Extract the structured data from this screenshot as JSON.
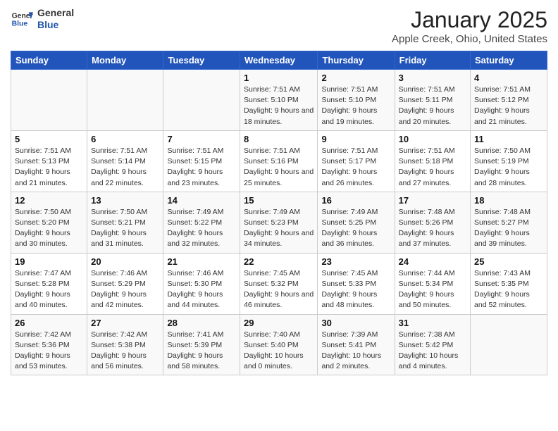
{
  "header": {
    "logo_general": "General",
    "logo_blue": "Blue",
    "month": "January 2025",
    "location": "Apple Creek, Ohio, United States"
  },
  "days_of_week": [
    "Sunday",
    "Monday",
    "Tuesday",
    "Wednesday",
    "Thursday",
    "Friday",
    "Saturday"
  ],
  "weeks": [
    [
      {
        "day": "",
        "info": ""
      },
      {
        "day": "",
        "info": ""
      },
      {
        "day": "",
        "info": ""
      },
      {
        "day": "1",
        "sunrise": "Sunrise: 7:51 AM",
        "sunset": "Sunset: 5:10 PM",
        "daylight": "Daylight: 9 hours and 18 minutes."
      },
      {
        "day": "2",
        "sunrise": "Sunrise: 7:51 AM",
        "sunset": "Sunset: 5:10 PM",
        "daylight": "Daylight: 9 hours and 19 minutes."
      },
      {
        "day": "3",
        "sunrise": "Sunrise: 7:51 AM",
        "sunset": "Sunset: 5:11 PM",
        "daylight": "Daylight: 9 hours and 20 minutes."
      },
      {
        "day": "4",
        "sunrise": "Sunrise: 7:51 AM",
        "sunset": "Sunset: 5:12 PM",
        "daylight": "Daylight: 9 hours and 21 minutes."
      }
    ],
    [
      {
        "day": "5",
        "sunrise": "Sunrise: 7:51 AM",
        "sunset": "Sunset: 5:13 PM",
        "daylight": "Daylight: 9 hours and 21 minutes."
      },
      {
        "day": "6",
        "sunrise": "Sunrise: 7:51 AM",
        "sunset": "Sunset: 5:14 PM",
        "daylight": "Daylight: 9 hours and 22 minutes."
      },
      {
        "day": "7",
        "sunrise": "Sunrise: 7:51 AM",
        "sunset": "Sunset: 5:15 PM",
        "daylight": "Daylight: 9 hours and 23 minutes."
      },
      {
        "day": "8",
        "sunrise": "Sunrise: 7:51 AM",
        "sunset": "Sunset: 5:16 PM",
        "daylight": "Daylight: 9 hours and 25 minutes."
      },
      {
        "day": "9",
        "sunrise": "Sunrise: 7:51 AM",
        "sunset": "Sunset: 5:17 PM",
        "daylight": "Daylight: 9 hours and 26 minutes."
      },
      {
        "day": "10",
        "sunrise": "Sunrise: 7:51 AM",
        "sunset": "Sunset: 5:18 PM",
        "daylight": "Daylight: 9 hours and 27 minutes."
      },
      {
        "day": "11",
        "sunrise": "Sunrise: 7:50 AM",
        "sunset": "Sunset: 5:19 PM",
        "daylight": "Daylight: 9 hours and 28 minutes."
      }
    ],
    [
      {
        "day": "12",
        "sunrise": "Sunrise: 7:50 AM",
        "sunset": "Sunset: 5:20 PM",
        "daylight": "Daylight: 9 hours and 30 minutes."
      },
      {
        "day": "13",
        "sunrise": "Sunrise: 7:50 AM",
        "sunset": "Sunset: 5:21 PM",
        "daylight": "Daylight: 9 hours and 31 minutes."
      },
      {
        "day": "14",
        "sunrise": "Sunrise: 7:49 AM",
        "sunset": "Sunset: 5:22 PM",
        "daylight": "Daylight: 9 hours and 32 minutes."
      },
      {
        "day": "15",
        "sunrise": "Sunrise: 7:49 AM",
        "sunset": "Sunset: 5:23 PM",
        "daylight": "Daylight: 9 hours and 34 minutes."
      },
      {
        "day": "16",
        "sunrise": "Sunrise: 7:49 AM",
        "sunset": "Sunset: 5:25 PM",
        "daylight": "Daylight: 9 hours and 36 minutes."
      },
      {
        "day": "17",
        "sunrise": "Sunrise: 7:48 AM",
        "sunset": "Sunset: 5:26 PM",
        "daylight": "Daylight: 9 hours and 37 minutes."
      },
      {
        "day": "18",
        "sunrise": "Sunrise: 7:48 AM",
        "sunset": "Sunset: 5:27 PM",
        "daylight": "Daylight: 9 hours and 39 minutes."
      }
    ],
    [
      {
        "day": "19",
        "sunrise": "Sunrise: 7:47 AM",
        "sunset": "Sunset: 5:28 PM",
        "daylight": "Daylight: 9 hours and 40 minutes."
      },
      {
        "day": "20",
        "sunrise": "Sunrise: 7:46 AM",
        "sunset": "Sunset: 5:29 PM",
        "daylight": "Daylight: 9 hours and 42 minutes."
      },
      {
        "day": "21",
        "sunrise": "Sunrise: 7:46 AM",
        "sunset": "Sunset: 5:30 PM",
        "daylight": "Daylight: 9 hours and 44 minutes."
      },
      {
        "day": "22",
        "sunrise": "Sunrise: 7:45 AM",
        "sunset": "Sunset: 5:32 PM",
        "daylight": "Daylight: 9 hours and 46 minutes."
      },
      {
        "day": "23",
        "sunrise": "Sunrise: 7:45 AM",
        "sunset": "Sunset: 5:33 PM",
        "daylight": "Daylight: 9 hours and 48 minutes."
      },
      {
        "day": "24",
        "sunrise": "Sunrise: 7:44 AM",
        "sunset": "Sunset: 5:34 PM",
        "daylight": "Daylight: 9 hours and 50 minutes."
      },
      {
        "day": "25",
        "sunrise": "Sunrise: 7:43 AM",
        "sunset": "Sunset: 5:35 PM",
        "daylight": "Daylight: 9 hours and 52 minutes."
      }
    ],
    [
      {
        "day": "26",
        "sunrise": "Sunrise: 7:42 AM",
        "sunset": "Sunset: 5:36 PM",
        "daylight": "Daylight: 9 hours and 53 minutes."
      },
      {
        "day": "27",
        "sunrise": "Sunrise: 7:42 AM",
        "sunset": "Sunset: 5:38 PM",
        "daylight": "Daylight: 9 hours and 56 minutes."
      },
      {
        "day": "28",
        "sunrise": "Sunrise: 7:41 AM",
        "sunset": "Sunset: 5:39 PM",
        "daylight": "Daylight: 9 hours and 58 minutes."
      },
      {
        "day": "29",
        "sunrise": "Sunrise: 7:40 AM",
        "sunset": "Sunset: 5:40 PM",
        "daylight": "Daylight: 10 hours and 0 minutes."
      },
      {
        "day": "30",
        "sunrise": "Sunrise: 7:39 AM",
        "sunset": "Sunset: 5:41 PM",
        "daylight": "Daylight: 10 hours and 2 minutes."
      },
      {
        "day": "31",
        "sunrise": "Sunrise: 7:38 AM",
        "sunset": "Sunset: 5:42 PM",
        "daylight": "Daylight: 10 hours and 4 minutes."
      },
      {
        "day": "",
        "info": ""
      }
    ]
  ]
}
